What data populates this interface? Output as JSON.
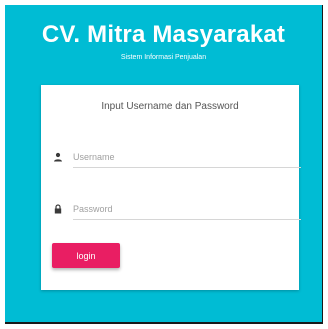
{
  "brand": {
    "title": "CV. Mitra Masyarakat",
    "subtitle": "Sistem Informasi Penjualan"
  },
  "login_form": {
    "heading": "Input Username dan Password",
    "username": {
      "value": "",
      "placeholder": "Username",
      "icon": "person-icon"
    },
    "password": {
      "value": "",
      "placeholder": "Password",
      "icon": "lock-icon"
    },
    "submit_label": "login"
  },
  "colors": {
    "background": "#00bcd4",
    "card": "#ffffff",
    "button": "#e91e63",
    "text_muted": "#a0a0a0"
  }
}
